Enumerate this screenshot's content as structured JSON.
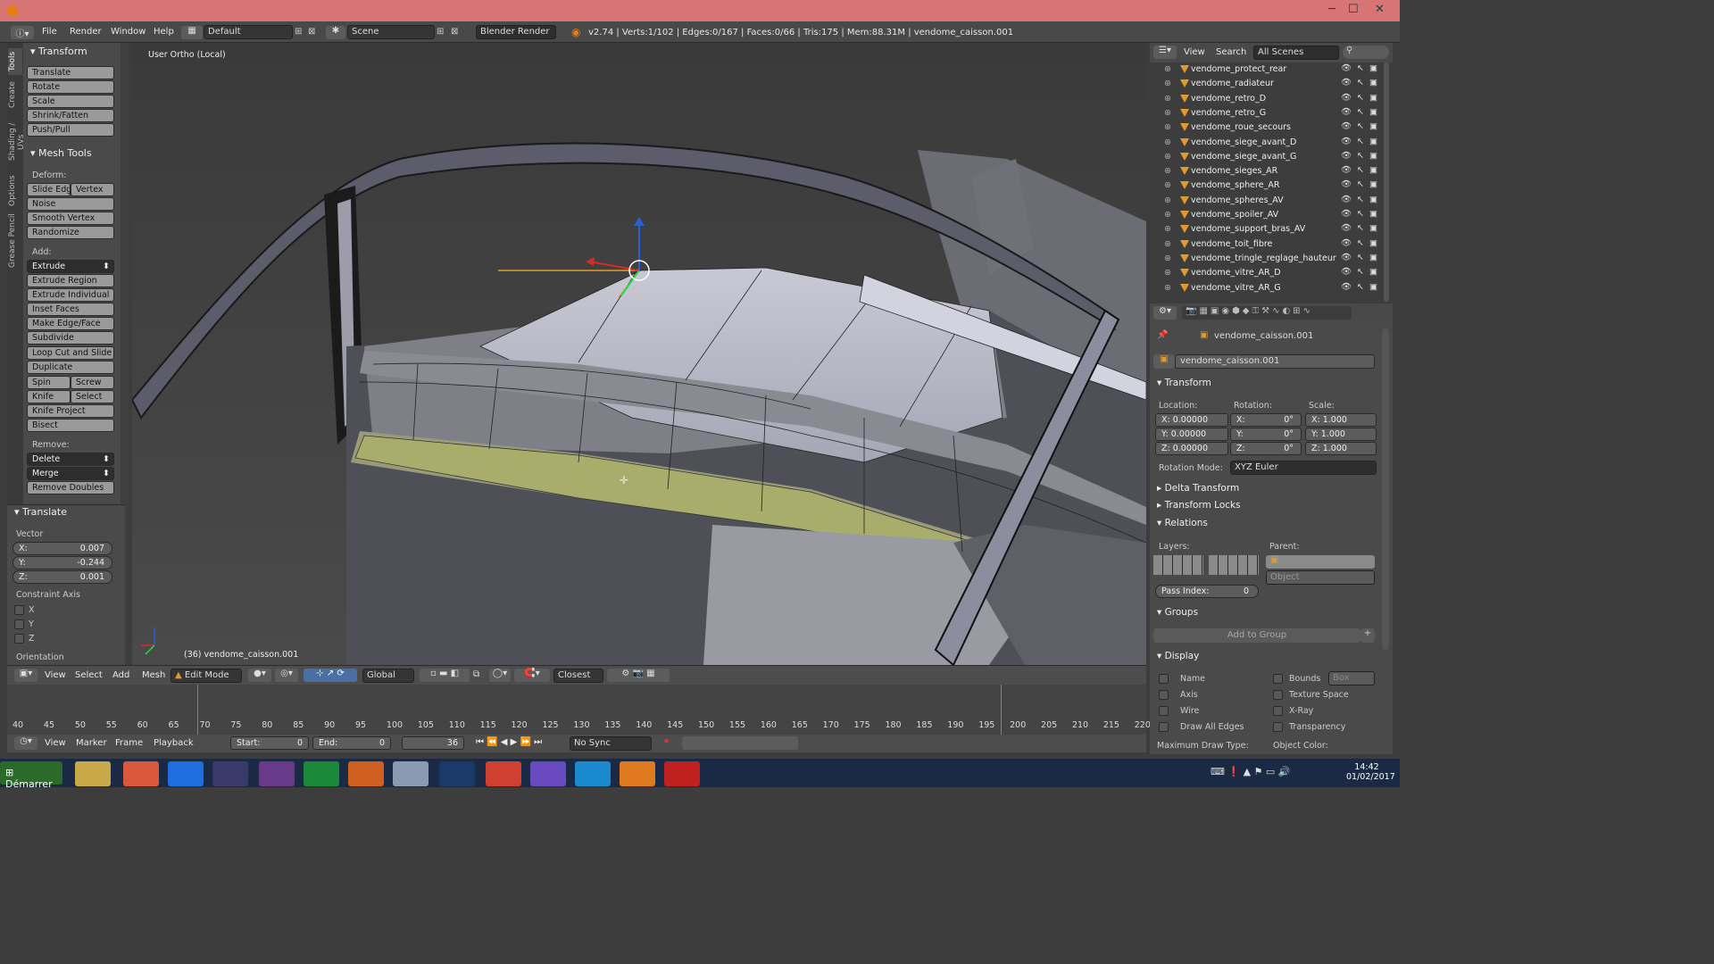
{
  "window": {
    "controls": [
      "─",
      "☐",
      "✕"
    ]
  },
  "topbar": {
    "menus": [
      "File",
      "Render",
      "Window",
      "Help"
    ],
    "layout": "Default",
    "scene": "Scene",
    "engine": "Blender Render",
    "stats": "v2.74 | Verts:1/102 | Edges:0/167 | Faces:0/66 | Tris:175 | Mem:88.31M | vendome_caisson.001"
  },
  "toolshelf": {
    "tabs": [
      "Tools",
      "Create",
      "Shading / UVs",
      "Options",
      "Grease Pencil"
    ],
    "transform_title": "Transform",
    "transform": [
      "Translate",
      "Rotate",
      "Scale",
      "Shrink/Fatten",
      "Push/Pull"
    ],
    "mesh_tools_title": "Mesh Tools",
    "deform_label": "Deform:",
    "slide_edge": "Slide Edg",
    "vertex": "Vertex",
    "deform": [
      "Noise",
      "Smooth Vertex",
      "Randomize"
    ],
    "add_label": "Add:",
    "extrude": "Extrude",
    "add": [
      "Extrude Region",
      "Extrude Individual",
      "Inset Faces",
      "Make Edge/Face",
      "Subdivide",
      "Loop Cut and Slide",
      "Duplicate"
    ],
    "spin": "Spin",
    "screw": "Screw",
    "knife": "Knife",
    "select": "Select",
    "add2": [
      "Knife Project",
      "Bisect"
    ],
    "remove_label": "Remove:",
    "delete": "Delete",
    "merge": "Merge",
    "remove_doubles": "Remove Doubles",
    "op_title": "Translate",
    "vector_label": "Vector",
    "vx": "X:",
    "vxv": "0.007",
    "vy": "Y:",
    "vyv": "-0.244",
    "vz": "Z:",
    "vzv": "0.001",
    "constraint_label": "Constraint Axis",
    "cx": "X",
    "cy": "Y",
    "cz": "Z",
    "orientation_label": "Orientation"
  },
  "viewport": {
    "view_label": "User Ortho (Local)",
    "object_label": "(36) vendome_caisson.001"
  },
  "view3d_header": {
    "menus": [
      "View",
      "Select",
      "Add",
      "Mesh"
    ],
    "mode": "Edit Mode",
    "orientation": "Global",
    "snap": "Closest"
  },
  "timeline": {
    "ticks": [
      "40",
      "45",
      "50",
      "55",
      "60",
      "65",
      "70",
      "75",
      "80",
      "85",
      "90",
      "95",
      "100",
      "105",
      "110",
      "115",
      "120",
      "125",
      "130",
      "135",
      "140",
      "145",
      "150",
      "155",
      "160",
      "165",
      "170",
      "175",
      "180",
      "185",
      "190",
      "195",
      "200",
      "205",
      "210",
      "215",
      "220"
    ],
    "menus": [
      "View",
      "Marker",
      "Frame",
      "Playback"
    ],
    "start": "Start:",
    "start_val": "0",
    "end": "End:",
    "end_val": "0",
    "current": "36",
    "sync": "No Sync"
  },
  "outliner": {
    "menus": [
      "View",
      "Search"
    ],
    "scope": "All Scenes",
    "items": [
      "vendome_protect_rear",
      "vendome_radiateur",
      "vendome_retro_D",
      "vendome_retro_G",
      "vendome_roue_secours",
      "vendome_siege_avant_D",
      "vendome_siege_avant_G",
      "vendome_sieges_AR",
      "vendome_sphere_AR",
      "vendome_spheres_AV",
      "vendome_spoiler_AV",
      "vendome_support_bras_AV",
      "vendome_toit_fibre",
      "vendome_tringle_reglage_hauteur",
      "vendome_vitre_AR_D",
      "vendome_vitre_AR_G"
    ]
  },
  "properties": {
    "breadcrumb": "vendome_caisson.001",
    "object_name": "vendome_caisson.001",
    "transform_title": "Transform",
    "location_label": "Location:",
    "rotation_label": "Rotation:",
    "scale_label": "Scale:",
    "loc": [
      "X: 0.00000",
      "Y: 0.00000",
      "Z: 0.00000"
    ],
    "rot_axes": [
      "X:",
      "Y:",
      "Z:"
    ],
    "rot_vals": [
      "0°",
      "0°",
      "0°"
    ],
    "scale": [
      "X: 1.000",
      "Y: 1.000",
      "Z: 1.000"
    ],
    "rotation_mode_label": "Rotation Mode:",
    "rotation_mode": "XYZ Euler",
    "delta": "Delta Transform",
    "locks": "Transform Locks",
    "relations": "Relations",
    "layers_label": "Layers:",
    "parent_label": "Parent:",
    "parent_type": "Object",
    "pass_index_label": "Pass Index:",
    "pass_index": "0",
    "groups": "Groups",
    "add_to_group": "Add to Group",
    "display": "Display",
    "disp_left": [
      "Name",
      "Axis",
      "Wire",
      "Draw All Edges"
    ],
    "disp_right": [
      "Bounds",
      "Texture Space",
      "X-Ray",
      "Transparency"
    ],
    "bounds_type": "Box",
    "max_draw_type": "Maximum Draw Type:",
    "object_color": "Object Color:"
  },
  "taskbar": {
    "start": "Démarrer",
    "time": "14:42",
    "date": "01/02/2017"
  }
}
